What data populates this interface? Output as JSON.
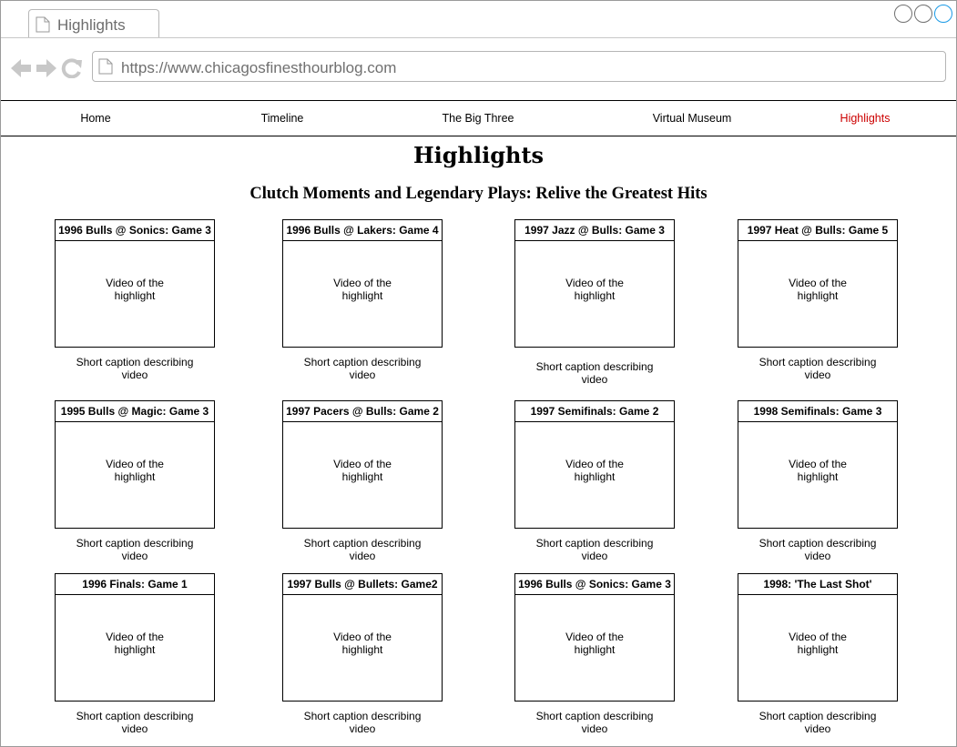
{
  "browser": {
    "tab_title": "Highlights",
    "url": "https://www.chicagosfinesthourblog.com"
  },
  "nav": {
    "items": [
      "Home",
      "Timeline",
      "The Big Three",
      "Virtual Museum",
      "Highlights"
    ],
    "active": "Highlights",
    "active_color": "#cc0000"
  },
  "page": {
    "title": "Highlights",
    "subtitle": "Clutch Moments and Legendary Plays: Relive the Greatest Hits"
  },
  "highlights": [
    {
      "title": "1996 Bulls @ Sonics: Game 3",
      "video": "Video of the highlight",
      "caption": "Short caption describing video"
    },
    {
      "title": "1996 Bulls @ Lakers: Game 4",
      "video": "Video of the highlight",
      "caption": "Short caption describing video"
    },
    {
      "title": "1997 Jazz @ Bulls: Game 3",
      "video": "Video of the highlight",
      "caption": "Short caption describing video"
    },
    {
      "title": "1997 Heat @ Bulls: Game 5",
      "video": "Video of the highlight",
      "caption": "Short caption describing video"
    },
    {
      "title": "1995 Bulls @ Magic: Game 3",
      "video": "Video of the highlight",
      "caption": "Short caption describing video"
    },
    {
      "title": "1997 Pacers @ Bulls: Game 2",
      "video": "Video of the highlight",
      "caption": "Short caption describing video"
    },
    {
      "title": "1997 Semifinals: Game 2",
      "video": "Video of the highlight",
      "caption": "Short caption describing video"
    },
    {
      "title": "1998 Semifinals: Game 3",
      "video": "Video of the highlight",
      "caption": "Short caption describing video"
    },
    {
      "title": "1996 Finals: Game 1",
      "video": "Video of the highlight",
      "caption": "Short caption describing video"
    },
    {
      "title": "1997 Bulls @ Bullets: Game2",
      "video": "Video of the highlight",
      "caption": "Short caption describing video"
    },
    {
      "title": "1996 Bulls @ Sonics: Game 3",
      "video": "Video of the highlight",
      "caption": "Short caption describing video"
    },
    {
      "title": "1998: 'The Last Shot'",
      "video": "Video of the highlight",
      "caption": "Short caption describing video"
    }
  ]
}
